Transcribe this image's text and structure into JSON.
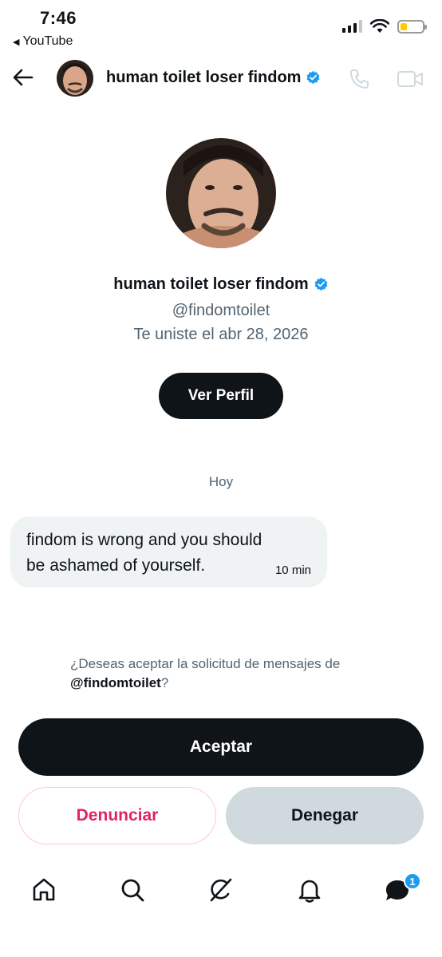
{
  "status_bar": {
    "time": "7:46",
    "back_app": "YouTube"
  },
  "header": {
    "name": "human toilet loser findom"
  },
  "profile": {
    "name": "human toilet loser findom",
    "handle": "@findomtoilet",
    "joined": "Te uniste el abr 28, 2026",
    "view_profile_label": "Ver Perfil"
  },
  "conversation": {
    "day_label": "Hoy",
    "messages": [
      {
        "text": "findom is wrong and you should be ashamed of yourself.",
        "time": "10 min"
      }
    ]
  },
  "request": {
    "question": "¿Deseas aceptar la solicitud de mensajes de",
    "handle": "@findomtoilet",
    "suffix": "?",
    "accept_label": "Aceptar",
    "report_label": "Denunciar",
    "deny_label": "Denegar"
  },
  "tabbar": {
    "messages_badge": "1",
    "icons": [
      "home-icon",
      "search-icon",
      "grok-icon",
      "notifications-icon",
      "messages-icon"
    ]
  },
  "colors": {
    "accent": "#1d9bf0",
    "dark": "#0f1419",
    "danger": "#e0245e",
    "muted": "#536471",
    "bubble": "#eff3f4"
  }
}
